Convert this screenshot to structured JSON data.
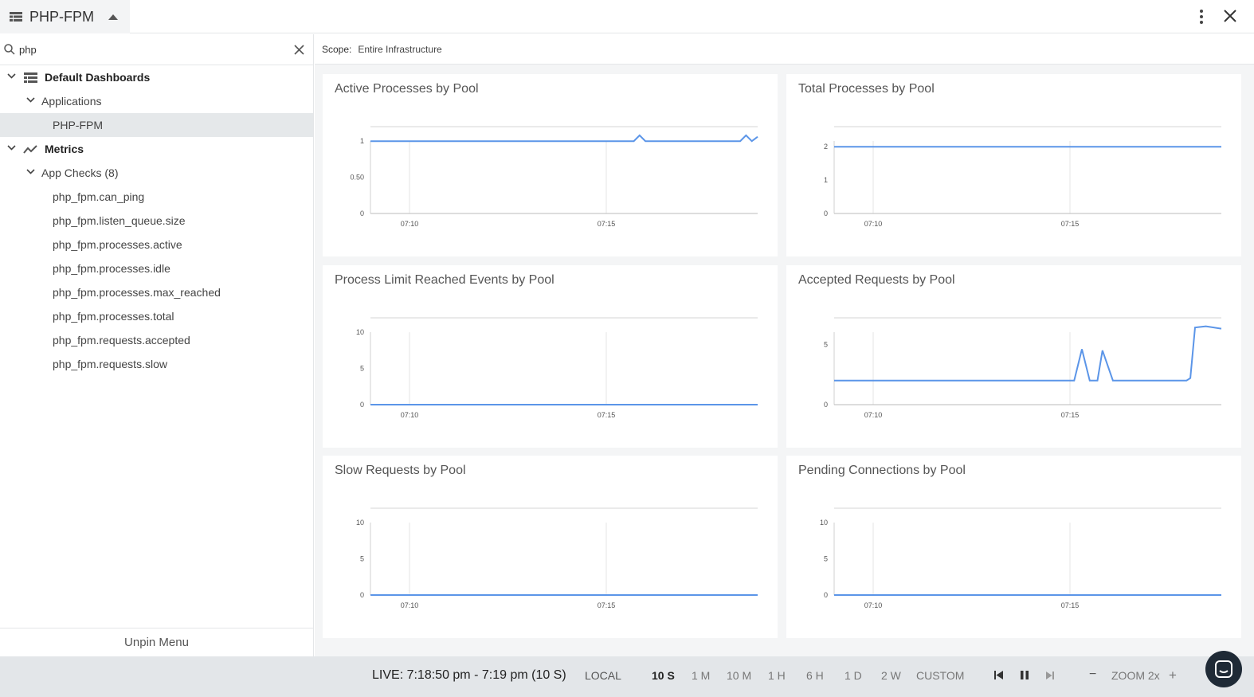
{
  "header": {
    "dashboard_title": "PHP-FPM"
  },
  "sidebar": {
    "search": {
      "value": "php",
      "placeholder": ""
    },
    "tree": {
      "default_dashboards": "Default Dashboards",
      "applications": "Applications",
      "php_fpm": "PHP-FPM",
      "metrics": "Metrics",
      "app_checks": "App Checks (8)",
      "metric_items": [
        "php_fpm.can_ping",
        "php_fpm.listen_queue.size",
        "php_fpm.processes.active",
        "php_fpm.processes.idle",
        "php_fpm.processes.max_reached",
        "php_fpm.processes.total",
        "php_fpm.requests.accepted",
        "php_fpm.requests.slow"
      ]
    },
    "unpin_label": "Unpin Menu"
  },
  "scope": {
    "label": "Scope:",
    "value": "Entire Infrastructure"
  },
  "colors": {
    "line": "#5b95e8",
    "grid": "#e4e4e4",
    "axis": "#d0d0d0"
  },
  "chart_data": [
    {
      "type": "line",
      "title": "Active Processes by Pool",
      "x_ticks": [
        "07:10",
        "07:15"
      ],
      "y_ticks": [
        "0",
        "0.50",
        "1"
      ],
      "ylim": [
        0,
        1.2
      ],
      "series": [
        {
          "x": [
            0,
            0.68,
            0.695,
            0.71,
            0.955,
            0.97,
            0.985,
            1.0
          ],
          "y": [
            1,
            1,
            1.08,
            1,
            1,
            1.08,
            1,
            1.06
          ]
        }
      ]
    },
    {
      "type": "line",
      "title": "Total Processes by Pool",
      "x_ticks": [
        "07:10",
        "07:15"
      ],
      "y_ticks": [
        "0",
        "1",
        "2"
      ],
      "ylim": [
        0,
        2.6
      ],
      "series": [
        {
          "x": [
            0,
            1
          ],
          "y": [
            2,
            2
          ]
        }
      ]
    },
    {
      "type": "line",
      "title": "Process Limit Reached Events by Pool",
      "x_ticks": [
        "07:10",
        "07:15"
      ],
      "y_ticks": [
        "0",
        "5",
        "10"
      ],
      "ylim": [
        0,
        12
      ],
      "series": [
        {
          "x": [
            0,
            1
          ],
          "y": [
            0,
            0
          ]
        }
      ]
    },
    {
      "type": "line",
      "title": "Accepted Requests by Pool",
      "x_ticks": [
        "07:10",
        "07:15"
      ],
      "y_ticks": [
        "0",
        "5"
      ],
      "ylim": [
        0,
        7.2
      ],
      "series": [
        {
          "x": [
            0,
            0.62,
            0.64,
            0.66,
            0.68,
            0.693,
            0.72,
            0.91,
            0.92,
            0.932,
            0.96,
            1.0
          ],
          "y": [
            2,
            2,
            4.6,
            2,
            2,
            4.5,
            2,
            2,
            2.2,
            6.4,
            6.5,
            6.3
          ]
        }
      ]
    },
    {
      "type": "line",
      "title": "Slow Requests by Pool",
      "x_ticks": [
        "07:10",
        "07:15"
      ],
      "y_ticks": [
        "0",
        "5",
        "10"
      ],
      "ylim": [
        0,
        12
      ],
      "series": [
        {
          "x": [
            0,
            1
          ],
          "y": [
            0,
            0
          ]
        }
      ]
    },
    {
      "type": "line",
      "title": "Pending Connections by Pool",
      "x_ticks": [
        "07:10",
        "07:15"
      ],
      "y_ticks": [
        "0",
        "5",
        "10"
      ],
      "ylim": [
        0,
        12
      ],
      "series": [
        {
          "x": [
            0,
            1
          ],
          "y": [
            0,
            0
          ]
        }
      ]
    }
  ],
  "timebar": {
    "live": "LIVE: 7:18:50 pm - 7:19 pm (10 S)",
    "local": "LOCAL",
    "ranges": [
      "10 S",
      "1 M",
      "10 M",
      "1 H",
      "6 H",
      "1 D",
      "2 W",
      "CUSTOM"
    ],
    "active_range": "10 S",
    "zoom_label": "ZOOM 2x",
    "zoom_out": "−",
    "zoom_in": "+"
  }
}
